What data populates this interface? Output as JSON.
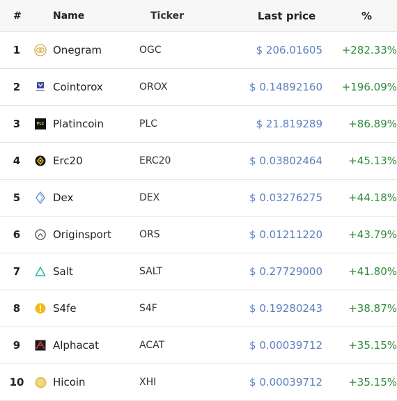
{
  "header": {
    "rank": "#",
    "name": "Name",
    "ticker": "Ticker",
    "price": "Last price",
    "pct": "%"
  },
  "rows": [
    {
      "rank": "1",
      "name": "Onegram",
      "ticker": "OGC",
      "price": "$ 206.01605",
      "pct": "+282.33%",
      "icon": "onegram-logo-icon"
    },
    {
      "rank": "2",
      "name": "Cointorox",
      "ticker": "OROX",
      "price": "$ 0.14892160",
      "pct": "+196.09%",
      "icon": "cointorox-logo-icon"
    },
    {
      "rank": "3",
      "name": "Platincoin",
      "ticker": "PLC",
      "price": "$ 21.819289",
      "pct": "+86.89%",
      "icon": "platincoin-logo-icon",
      "icon_text": "PLC"
    },
    {
      "rank": "4",
      "name": "Erc20",
      "ticker": "ERC20",
      "price": "$ 0.03802464",
      "pct": "+45.13%",
      "icon": "erc20-logo-icon"
    },
    {
      "rank": "5",
      "name": "Dex",
      "ticker": "DEX",
      "price": "$ 0.03276275",
      "pct": "+44.18%",
      "icon": "dex-logo-icon"
    },
    {
      "rank": "6",
      "name": "Originsport",
      "ticker": "ORS",
      "price": "$ 0.01211220",
      "pct": "+43.79%",
      "icon": "originsport-logo-icon"
    },
    {
      "rank": "7",
      "name": "Salt",
      "ticker": "SALT",
      "price": "$ 0.27729000",
      "pct": "+41.80%",
      "icon": "salt-logo-icon"
    },
    {
      "rank": "8",
      "name": "S4fe",
      "ticker": "S4F",
      "price": "$ 0.19280243",
      "pct": "+38.87%",
      "icon": "s4fe-logo-icon"
    },
    {
      "rank": "9",
      "name": "Alphacat",
      "ticker": "ACAT",
      "price": "$ 0.00039712",
      "pct": "+35.15%",
      "icon": "alphacat-logo-icon"
    },
    {
      "rank": "10",
      "name": "Hicoin",
      "ticker": "XHI",
      "price": "$ 0.00039712",
      "pct": "+35.15%",
      "icon": "hicoin-logo-icon"
    }
  ],
  "colors": {
    "price": "#5b7fbf",
    "change_positive": "#2e8b3a",
    "header_bg": "#f7f7f7"
  }
}
